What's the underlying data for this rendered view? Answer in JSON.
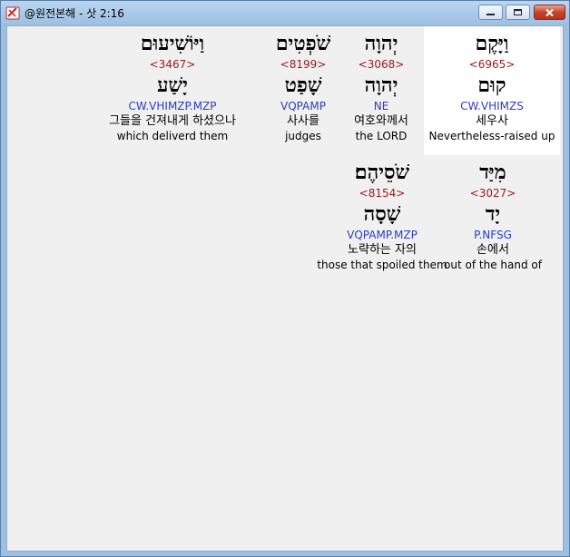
{
  "window": {
    "title": "@원전본해 - 삿 2:16",
    "controls": {
      "minimize": "minimize-icon",
      "maximize": "maximize-icon",
      "close": "close-icon"
    }
  },
  "words": [
    {
      "hebrew": "וַיָּקֶם",
      "strong": "<6965>",
      "lemma": "קוּם",
      "morph": "CW.VHIMZS",
      "korean": "세우사",
      "english": "Nevertheless-raised up",
      "highlighted": true
    },
    {
      "hebrew": "יְהוָה",
      "strong": "<3068>",
      "lemma": "יְהוָה",
      "morph": "NE",
      "korean": "여호와께서",
      "english": "the LORD",
      "highlighted": false
    },
    {
      "hebrew": "שֹׁפְטִים",
      "strong": "<8199>",
      "lemma": "שָׁפַט",
      "morph": "VQPAMP",
      "korean": "사사를",
      "english": "judges",
      "highlighted": false
    },
    {
      "hebrew": "וַיּוֹשִׁיעוּם",
      "strong": "<3467>",
      "lemma": "יָשַׁע",
      "morph": "CW.VHIMZP.MZP",
      "korean": "그들을 건져내게 하셨으나",
      "english": "which deliverd them",
      "highlighted": false
    },
    {
      "hebrew": "מִיַּד",
      "strong": "<3027>",
      "lemma": "יָד",
      "morph": "P.NFSG",
      "korean": "손에서",
      "english": "out of the hand of",
      "highlighted": false
    },
    {
      "hebrew": "שֹׁסֵיהֶם׃",
      "strong": "<8154>",
      "lemma": "שָׁסָה",
      "morph": "VQPAMP.MZP",
      "korean": "노략하는 자의",
      "english": "those that spoiled them",
      "highlighted": false
    }
  ]
}
